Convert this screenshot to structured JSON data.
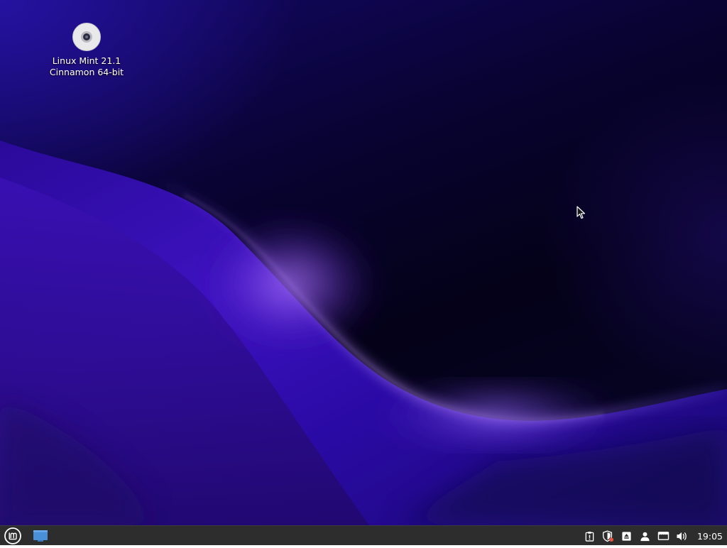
{
  "desktop": {
    "icons": [
      {
        "line1": "Linux Mint 21.1",
        "line2": "Cinnamon 64-bit",
        "icon": "disc-icon"
      }
    ]
  },
  "panel": {
    "menu_icon": "linux-mint-logo-icon",
    "show_desktop_icon": "show-desktop-icon",
    "tray": [
      "clipboard-icon",
      "update-manager-shield-icon",
      "removable-drives-eject-icon",
      "user-icon",
      "network-icon",
      "volume-icon"
    ],
    "clock": "19:05"
  },
  "colors": {
    "panel": "#2d2d2d",
    "accent": "#4a90d9",
    "wallpaper_dark": "#040118",
    "wallpaper_violet": "#8a4fe0"
  }
}
